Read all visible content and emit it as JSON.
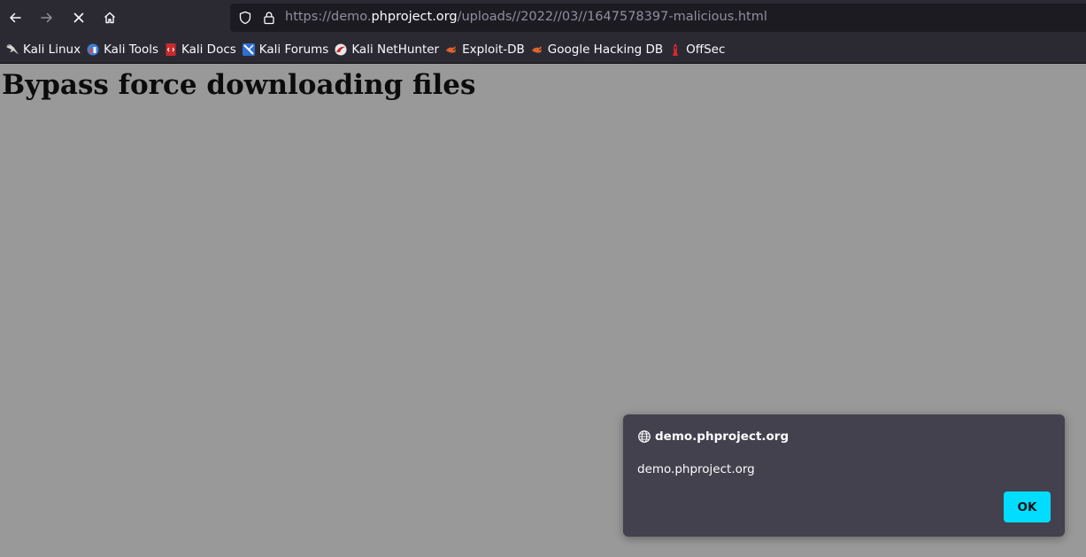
{
  "browser": {
    "url": {
      "scheme": "https://",
      "subdomain": "demo.",
      "host": "phproject.org",
      "path": "/uploads//2022//03//1647578397-malicious.html"
    },
    "nav_icons": [
      "back-icon",
      "forward-icon",
      "stop-icon",
      "home-icon"
    ],
    "url_icons": [
      "shield-icon",
      "lock-icon"
    ]
  },
  "bookmarks": [
    {
      "label": "Kali Linux",
      "icon": "kali-dragon-icon"
    },
    {
      "label": "Kali Tools",
      "icon": "kali-tools-icon"
    },
    {
      "label": "Kali Docs",
      "icon": "kali-docs-icon"
    },
    {
      "label": "Kali Forums",
      "icon": "kali-forums-icon"
    },
    {
      "label": "Kali NetHunter",
      "icon": "kali-nethunter-icon"
    },
    {
      "label": "Exploit-DB",
      "icon": "exploit-db-icon"
    },
    {
      "label": "Google Hacking DB",
      "icon": "exploit-db-icon"
    },
    {
      "label": "OffSec",
      "icon": "offsec-icon"
    }
  ],
  "page": {
    "heading": "Bypass force downloading files"
  },
  "dialog": {
    "title": "demo.phproject.org",
    "message": "demo.phproject.org",
    "ok_label": "OK"
  },
  "colors": {
    "chrome": "#2b2a33",
    "urlbar": "#1c1b22",
    "page_overlay": "#999999",
    "dialog_bg": "#42414d",
    "accent": "#00ddff"
  }
}
